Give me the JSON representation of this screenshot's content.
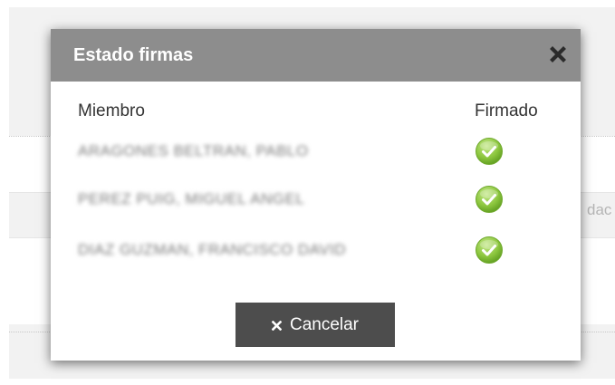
{
  "modal": {
    "title": "Estado firmas",
    "close_icon": "close-icon",
    "header_color": "#8d8d8d",
    "columns": {
      "member": "Miembro",
      "signed": "Firmado"
    },
    "members": [
      {
        "name": "ARAGONES BELTRAN, PABLO",
        "signed": true,
        "status_icon": "check-circle-icon"
      },
      {
        "name": "PEREZ PUIG, MIGUEL ANGEL",
        "signed": true,
        "status_icon": "check-circle-icon"
      },
      {
        "name": "DIAZ GUZMAN, FRANCISCO DAVID",
        "signed": true,
        "status_icon": "check-circle-icon"
      }
    ],
    "cancel_button": {
      "label": "Cancelar",
      "icon": "x-icon",
      "color": "#4d4d4d"
    }
  },
  "background": {
    "partial_text": "dac"
  },
  "colors": {
    "check_green": "#8cc63e",
    "text_dark": "#333333"
  }
}
